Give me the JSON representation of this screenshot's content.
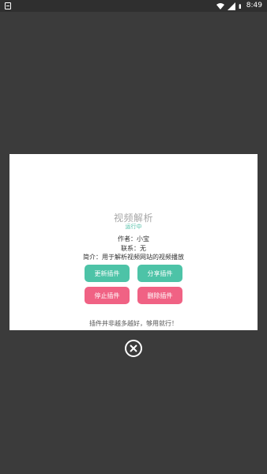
{
  "status_bar": {
    "time": "8:49",
    "left_icon": "notification-icon",
    "wifi_icon": "wifi-icon",
    "signal_icon": "signal-icon",
    "battery_icon": "battery-icon"
  },
  "dialog": {
    "title": "视频解析",
    "status": "运行中",
    "author": "作者：小宝",
    "contact": "联系：无",
    "intro": "简介：用于解析视频网站的视频播放",
    "buttons": {
      "update": "更新插件",
      "share": "分享插件",
      "stop": "停止插件",
      "delete": "删除插件"
    },
    "footer_note": "插件并非越多越好，够用就行！"
  },
  "close": {
    "icon": "close-circle-icon"
  },
  "colors": {
    "background": "#3b3b3b",
    "accent_green": "#4dc3a7",
    "accent_pink": "#f06284",
    "title_gray": "#a6a6a6"
  }
}
